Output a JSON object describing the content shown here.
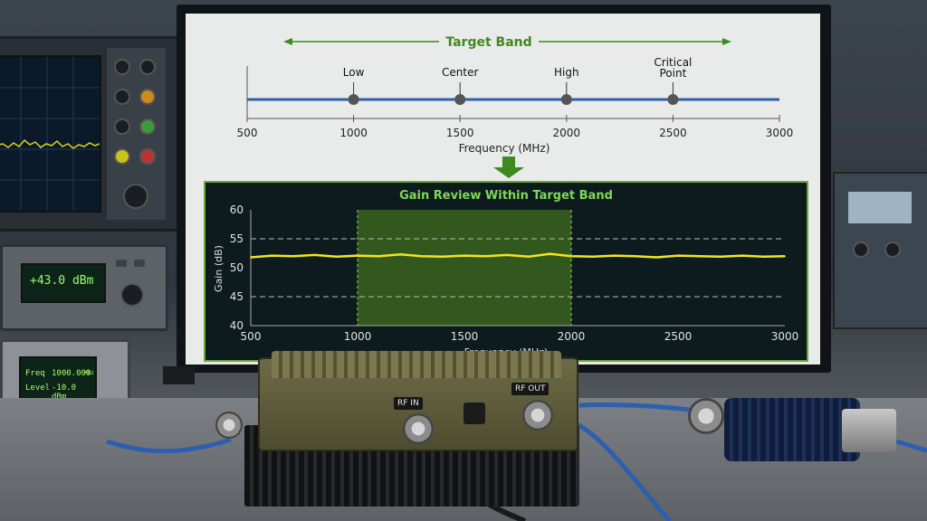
{
  "band_diagram": {
    "title": "Target Band",
    "axis_label": "Frequency (MHz)",
    "ticks": [
      "500",
      "1000",
      "1500",
      "2000",
      "2500",
      "3000"
    ],
    "markers": [
      {
        "label": "Low",
        "freq": 1000
      },
      {
        "label": "Center",
        "freq": 1500
      },
      {
        "label": "High",
        "freq": 2000
      },
      {
        "label": "Critical Point",
        "freq": 2500
      }
    ],
    "range": [
      500,
      3000
    ]
  },
  "gain_panel": {
    "title": "Gain Review Within Target Band"
  },
  "chart_data": {
    "type": "line",
    "title": "Gain Review Within Target Band",
    "xlabel": "Frequency (MHz)",
    "ylabel": "Gain (dB)",
    "xlim": [
      500,
      3000
    ],
    "ylim": [
      40,
      60
    ],
    "x_ticks": [
      "500",
      "1000",
      "1500",
      "2000",
      "2500",
      "3000"
    ],
    "y_ticks": [
      "40",
      "45",
      "50",
      "55",
      "60"
    ],
    "reference_lines": [
      45,
      55
    ],
    "highlight_band": [
      1000,
      2000
    ],
    "series": [
      {
        "color": "#f2e51c",
        "x": [
          500,
          600,
          700,
          800,
          900,
          1000,
          1100,
          1200,
          1300,
          1400,
          1500,
          1600,
          1700,
          1800,
          1900,
          2000,
          2100,
          2200,
          2300,
          2400,
          2500,
          2600,
          2700,
          2800,
          2900,
          3000
        ],
        "y": [
          51.8,
          52.1,
          52.0,
          52.2,
          51.9,
          52.1,
          52.0,
          52.3,
          52.0,
          51.9,
          52.1,
          52.0,
          52.2,
          51.9,
          52.4,
          52.0,
          51.9,
          52.1,
          52.0,
          51.8,
          52.1,
          52.0,
          51.9,
          52.1,
          51.9,
          52.0
        ]
      }
    ]
  },
  "instruments": {
    "power_meter_readout": "+43.0 dBm",
    "siggen_freq_label": "Freq",
    "siggen_freq_value": "1000.000",
    "siggen_freq_unit": "MHz",
    "siggen_level_label": "Level",
    "siggen_level_value": "-10.0 dBm",
    "amp_rf_in": "RF IN",
    "amp_rf_out": "RF OUT"
  },
  "colors": {
    "band_line": "#2f5fa8",
    "arrow_green": "#3f8a1f",
    "panel_border": "#6aa83c",
    "panel_bg": "#0e1b1e",
    "title_green": "#7ed957",
    "highlight": "#3f6d1f"
  }
}
